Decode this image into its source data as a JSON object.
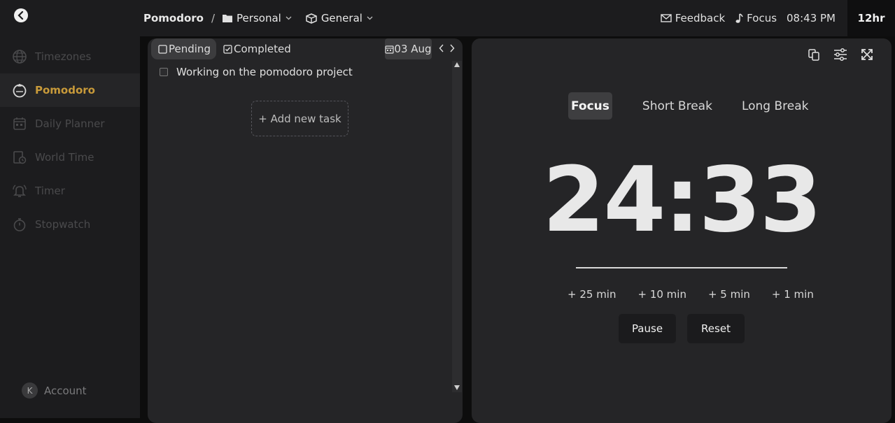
{
  "sidebar": {
    "items": [
      {
        "label": "Timezones",
        "icon": "globe-icon"
      },
      {
        "label": "Pomodoro",
        "icon": "tomato-icon",
        "active": true
      },
      {
        "label": "Daily Planner",
        "icon": "calendar-icon"
      },
      {
        "label": "World Time",
        "icon": "world-clock-icon"
      },
      {
        "label": "Timer",
        "icon": "alarm-bell-icon"
      },
      {
        "label": "Stopwatch",
        "icon": "stopwatch-icon"
      }
    ],
    "account": {
      "initial": "K",
      "label": "Account"
    }
  },
  "header": {
    "title": "Pomodoro",
    "separator": "/",
    "folder": "Personal",
    "category": "General",
    "feedback": "Feedback",
    "focus": "Focus",
    "time": "08:43 PM",
    "clock_format": "12hr"
  },
  "tasks": {
    "tabs": {
      "pending": "Pending",
      "completed": "Completed"
    },
    "date": "03 Aug",
    "items": [
      "Working on the pomodoro project"
    ],
    "add_label": "+ Add new task"
  },
  "timer": {
    "modes": [
      "Focus",
      "Short Break",
      "Long Break"
    ],
    "active_mode": "Focus",
    "display": "24:33",
    "increments": [
      "+ 25 min",
      "+ 10 min",
      "+ 5 min",
      "+ 1 min"
    ],
    "pause_label": "Pause",
    "reset_label": "Reset"
  },
  "colors": {
    "accent": "#c89a3a",
    "background": "#0d0d0d",
    "panel": "#252527",
    "sidebar": "#1c1c1e"
  }
}
